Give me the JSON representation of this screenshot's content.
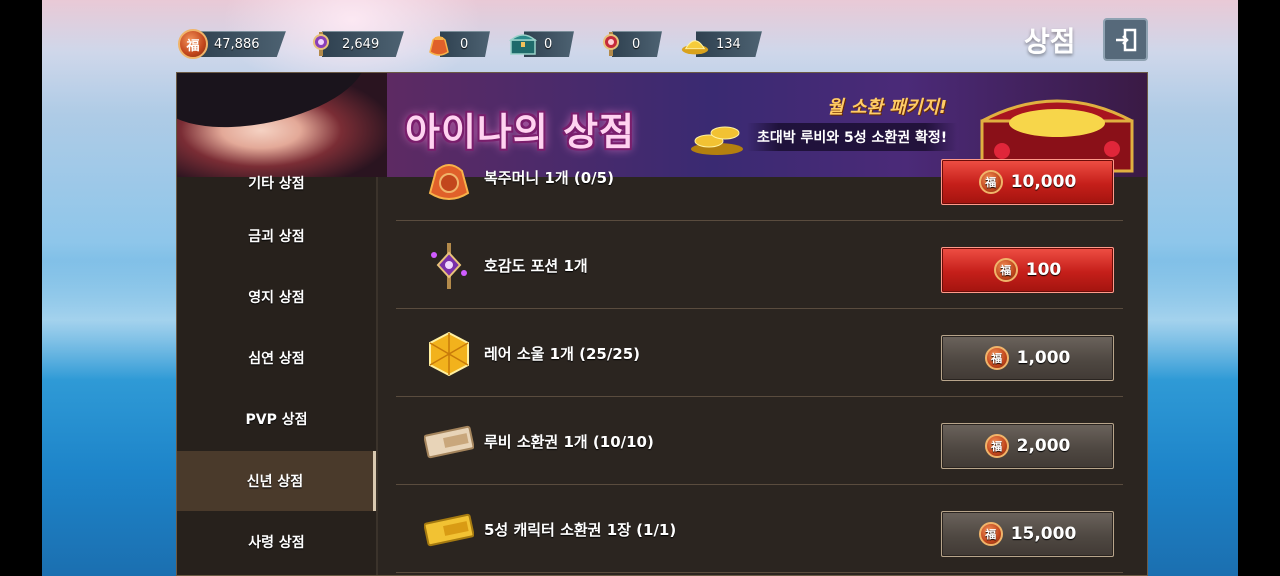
{
  "header": {
    "title": "상점",
    "resources": [
      {
        "icon": "fortune-coin-icon",
        "value": "47,886"
      },
      {
        "icon": "purple-scepter-icon",
        "value": "2,649"
      },
      {
        "icon": "lucky-pouch-icon",
        "value": "0"
      },
      {
        "icon": "treasure-chest-icon",
        "value": "0"
      },
      {
        "icon": "red-scepter-icon",
        "value": "0"
      },
      {
        "icon": "gold-pile-icon",
        "value": "134"
      }
    ],
    "coin_glyph": "福"
  },
  "banner": {
    "title": "아이나의 상점",
    "promo_title": "월 소환 패키지!",
    "promo_subtitle": "초대박 루비와 5성 소환권 확정!"
  },
  "sidebar": {
    "items": [
      {
        "label": "기타 상점"
      },
      {
        "label": "금괴 상점"
      },
      {
        "label": "영지 상점"
      },
      {
        "label": "심연 상점"
      },
      {
        "label": "PVP 상점"
      },
      {
        "label": "신년 상점",
        "active": true
      },
      {
        "label": "사령 상점"
      }
    ]
  },
  "shop": {
    "items": [
      {
        "name": "복주머니 1개 (0/5)",
        "price": "10,000",
        "style": "red",
        "icon": "lucky-pouch-icon"
      },
      {
        "name": "호감도 포션 1개",
        "price": "100",
        "style": "red",
        "icon": "affection-potion-icon"
      },
      {
        "name": "레어 소울 1개 (25/25)",
        "price": "1,000",
        "style": "grey",
        "icon": "rare-soul-icon"
      },
      {
        "name": "루비 소환권 1개 (10/10)",
        "price": "2,000",
        "style": "grey",
        "icon": "ruby-ticket-icon"
      },
      {
        "name": "5성 캐릭터 소환권 1장 (1/1)",
        "price": "15,000",
        "style": "grey",
        "icon": "five-star-ticket-icon"
      }
    ]
  },
  "colors": {
    "red_button": "#c51f1a",
    "grey_button": "#4f4842",
    "panel_bg": "#2b2520"
  }
}
